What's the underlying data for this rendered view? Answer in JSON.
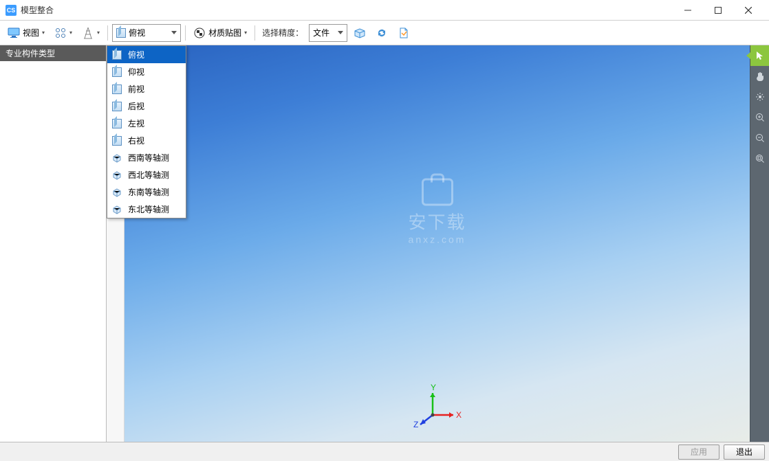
{
  "titlebar": {
    "logo": "CS",
    "title": "模型整合"
  },
  "toolbar": {
    "view_label": "视图",
    "current_view": "俯视",
    "material_label": "材质贴图",
    "precision_label": "选择精度：",
    "file_label": "文件"
  },
  "view_menu": {
    "items": [
      {
        "label": "俯视",
        "selected": true
      },
      {
        "label": "仰视",
        "selected": false
      },
      {
        "label": "前视",
        "selected": false
      },
      {
        "label": "后视",
        "selected": false
      },
      {
        "label": "左视",
        "selected": false
      },
      {
        "label": "右视",
        "selected": false
      },
      {
        "label": "西南等轴测",
        "selected": false
      },
      {
        "label": "西北等轴测",
        "selected": false
      },
      {
        "label": "东南等轴测",
        "selected": false
      },
      {
        "label": "东北等轴测",
        "selected": false
      }
    ]
  },
  "sidebar": {
    "header": "专业构件类型"
  },
  "watermark": {
    "line1": "安下载",
    "line2": "anxz.com"
  },
  "axis": {
    "x": "X",
    "y": "Y",
    "z": "Z"
  },
  "footer": {
    "apply": "应用",
    "exit": "退出"
  }
}
